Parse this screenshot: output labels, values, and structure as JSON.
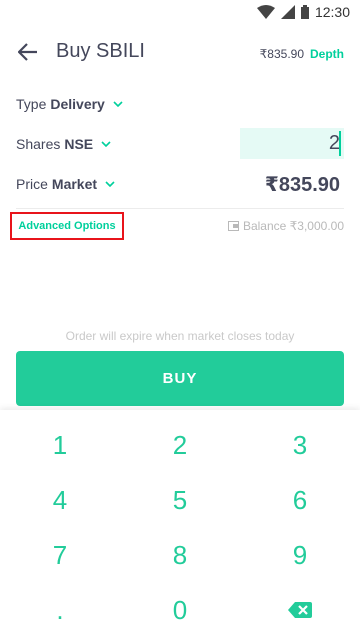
{
  "status_bar": {
    "time": "12:30"
  },
  "header": {
    "title": "Buy SBILI",
    "price": "₹835.90",
    "depth_label": "Depth"
  },
  "order": {
    "type_label": "Type",
    "type_value": "Delivery",
    "shares_label": "Shares",
    "exchange_value": "NSE",
    "quantity": "2",
    "price_label": "Price",
    "price_type": "Market",
    "price_value": "₹835.90"
  },
  "advanced_options_label": "Advanced Options",
  "balance_text": "Balance ₹3,000.00",
  "expire_note": "Order will expire when market closes today",
  "buy_label": "BUY",
  "keypad": {
    "keys": [
      "1",
      "2",
      "3",
      "4",
      "5",
      "6",
      "7",
      "8",
      "9",
      ".",
      "0"
    ],
    "backspace_icon": "backspace-icon"
  },
  "colors": {
    "accent": "#00d09c",
    "button": "#22cc9a",
    "highlight_border": "#e8141b",
    "text": "#44475b"
  }
}
